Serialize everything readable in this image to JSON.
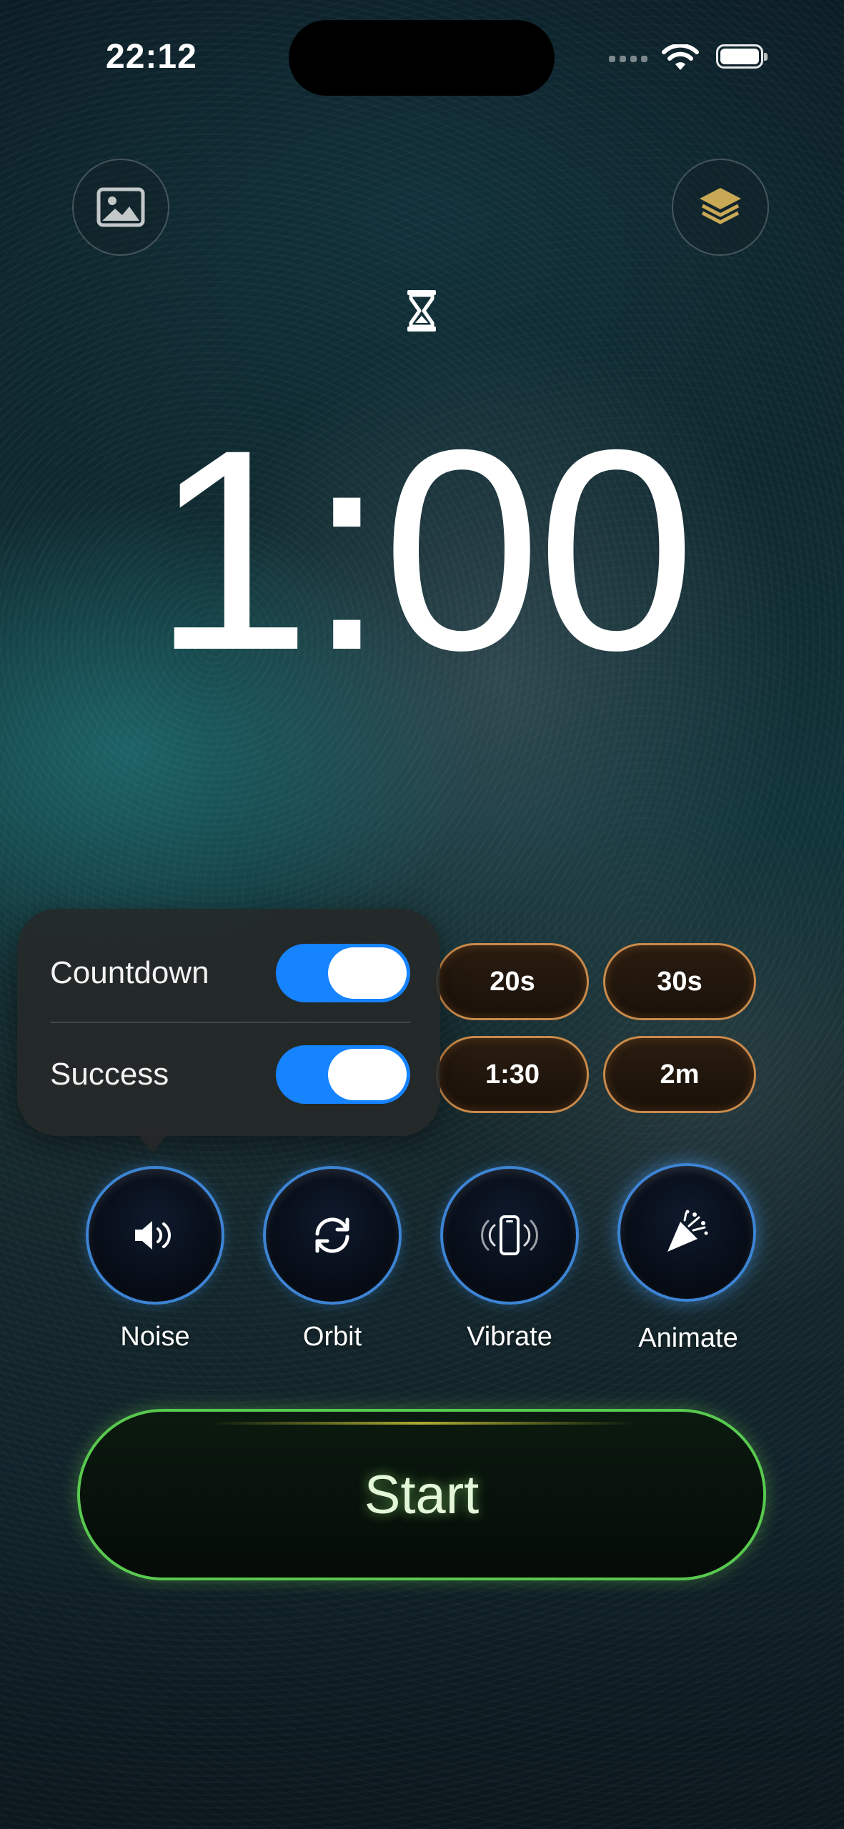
{
  "status_bar": {
    "time": "22:12"
  },
  "toolbar": {
    "left_icon": "photo-icon",
    "right_icon": "layers-icon"
  },
  "timer": {
    "icon": "hourglass-icon",
    "display": "1:00"
  },
  "sound_popover": {
    "rows": [
      {
        "label": "Countdown",
        "enabled": true
      },
      {
        "label": "Success",
        "enabled": true
      }
    ]
  },
  "presets": [
    "20s",
    "30s",
    "1:30",
    "2m"
  ],
  "features": [
    {
      "label": "Noise",
      "icon": "speaker-icon"
    },
    {
      "label": "Orbit",
      "icon": "rotate-icon"
    },
    {
      "label": "Vibrate",
      "icon": "vibrate-phone-icon"
    },
    {
      "label": "Animate",
      "icon": "party-popper-icon"
    }
  ],
  "start_button": {
    "label": "Start"
  },
  "colors": {
    "toggle_on": "#1683ff",
    "preset_border": "#c98a4b",
    "feature_ring": "#3d84d4",
    "start_border": "#58c94f"
  }
}
